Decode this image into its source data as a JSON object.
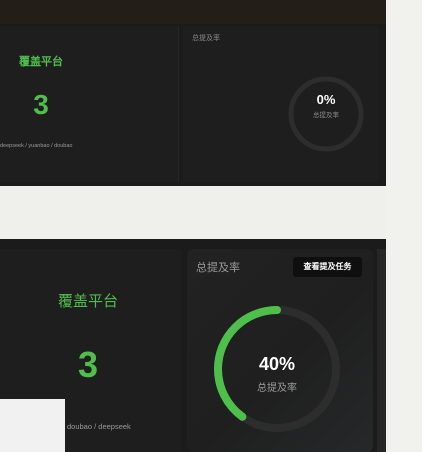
{
  "top_panel": {
    "coverage_card": {
      "title": "覆盖平台",
      "count": "3",
      "platforms": "deepseek / yuanbao / doubao"
    },
    "mention_card": {
      "label": "总提及率",
      "percent_text": "0%",
      "caption": "总提及率",
      "progress": 0
    }
  },
  "bottom_panel": {
    "coverage_card": {
      "title": "覆盖平台",
      "count": "3",
      "platforms": "doubao / deepseek"
    },
    "mention_card": {
      "label": "总提及率",
      "view_button": "查看提及任务",
      "percent_text": "40%",
      "caption": "总提及率",
      "progress": 0.4
    }
  },
  "colors": {
    "accent_green": "#4fbf4c",
    "ring_track": "#2d2d2d",
    "panel_bg": "#1b1b1b",
    "page_bg": "#efefeb"
  }
}
